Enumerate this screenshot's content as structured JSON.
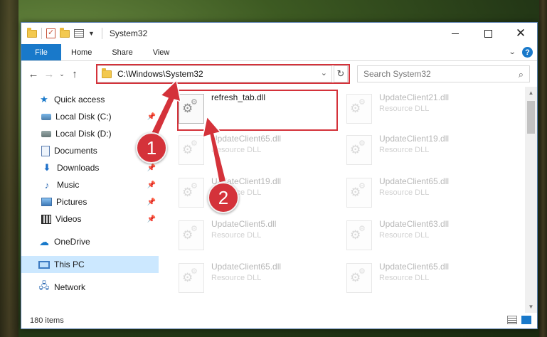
{
  "window": {
    "title": "System32",
    "controls": {
      "close": "✕"
    }
  },
  "ribbon": {
    "tabs": [
      "File",
      "Home",
      "Share",
      "View"
    ],
    "help": "?"
  },
  "address": {
    "path": "C:\\Windows\\System32",
    "search_placeholder": "Search System32"
  },
  "sidebar": {
    "items": [
      {
        "label": "Quick access",
        "icon": "star-icon",
        "pinned": false
      },
      {
        "label": "Local Disk (C:)",
        "icon": "drive-icon",
        "pinned": true
      },
      {
        "label": "Local Disk (D:)",
        "icon": "drive-icon",
        "pinned": false
      },
      {
        "label": "Documents",
        "icon": "document-icon",
        "pinned": true
      },
      {
        "label": "Downloads",
        "icon": "download-icon",
        "pinned": true
      },
      {
        "label": "Music",
        "icon": "music-icon",
        "pinned": true
      },
      {
        "label": "Pictures",
        "icon": "pictures-icon",
        "pinned": true
      },
      {
        "label": "Videos",
        "icon": "videos-icon",
        "pinned": true
      },
      {
        "label": "OneDrive",
        "icon": "cloud-icon",
        "pinned": false
      },
      {
        "label": "This PC",
        "icon": "computer-icon",
        "pinned": false,
        "selected": true
      },
      {
        "label": "Network",
        "icon": "network-icon",
        "pinned": false
      }
    ]
  },
  "files": [
    {
      "name": "refresh_tab.dll",
      "type": "",
      "faded": false
    },
    {
      "name": "UpdateClient21.dll",
      "type": "Resource DLL",
      "faded": true
    },
    {
      "name": "UpdateClient65.dll",
      "type": "Resource DLL",
      "faded": true
    },
    {
      "name": "UpdateClient19.dll",
      "type": "Resource DLL",
      "faded": true
    },
    {
      "name": "UpdateClient19.dll",
      "type": "Resource DLL",
      "faded": true
    },
    {
      "name": "UpdateClient65.dll",
      "type": "Resource DLL",
      "faded": true
    },
    {
      "name": "UpdateClient5.dll",
      "type": "Resource DLL",
      "faded": true
    },
    {
      "name": "UpdateClient63.dll",
      "type": "Resource DLL",
      "faded": true
    },
    {
      "name": "UpdateClient65.dll",
      "type": "Resource DLL",
      "faded": true
    },
    {
      "name": "UpdateClient65.dll",
      "type": "Resource DLL",
      "faded": true
    }
  ],
  "status": {
    "item_count": "180 items"
  },
  "annotations": {
    "callout_1": "1",
    "callout_2": "2",
    "accent": "#d4323a"
  },
  "colors": {
    "file_tab": "#1979ca",
    "selected_nav": "#cce8ff"
  }
}
